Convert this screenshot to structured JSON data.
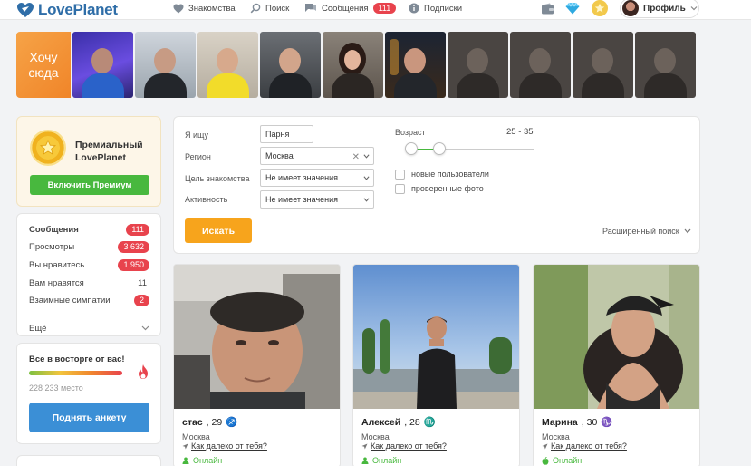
{
  "header": {
    "logo": "LovePlanet",
    "nav": [
      {
        "label": "Знакомства",
        "icon": "heart-icon"
      },
      {
        "label": "Поиск",
        "icon": "search-icon"
      },
      {
        "label": "Сообщения",
        "icon": "messages-icon",
        "badge": "111"
      },
      {
        "label": "Подписки",
        "icon": "info-icon"
      }
    ],
    "icons": [
      "wallet-icon",
      "diamond-icon",
      "star-icon"
    ],
    "profile_label": "Профиль"
  },
  "strip": {
    "want_here": "Хочу сюда",
    "photo_count": 10
  },
  "premium": {
    "title": "Премиальный LovePlanet",
    "button": "Включить Премиум"
  },
  "stats": {
    "items": [
      {
        "label": "Сообщения",
        "value": "111",
        "badge": true,
        "bold": true
      },
      {
        "label": "Просмотры",
        "value": "3 632",
        "badge": true
      },
      {
        "label": "Вы нравитесь",
        "value": "1 950",
        "badge": true
      },
      {
        "label": "Вам нравятся",
        "value": "11",
        "badge": false
      },
      {
        "label": "Взаимные симпатии",
        "value": "2",
        "badge": true
      }
    ],
    "more": "Ещё"
  },
  "delight": {
    "title": "Все в восторге от вас!",
    "place": "228 233 место",
    "button": "Поднять анкету"
  },
  "search": {
    "looking_for_label": "Я ищу",
    "looking_for_value": "Парня",
    "region_label": "Регион",
    "region_value": "Москва",
    "goal_label": "Цель знакомства",
    "goal_value": "Не имеет значения",
    "activity_label": "Активность",
    "activity_value": "Не имеет значения",
    "age_label": "Возраст",
    "age_range": "25 - 35",
    "checkbox_new": "новые пользователи",
    "checkbox_verified": "проверенные фото",
    "search_button": "Искать",
    "advanced": "Расширенный поиск"
  },
  "profiles": [
    {
      "name": "стас",
      "age": ", 29",
      "sign": "♐",
      "city": "Москва",
      "distance_link": "Как далеко от тебя?",
      "status": "Онлайн",
      "status_icon": "person-icon"
    },
    {
      "name": "Алексей",
      "age": ", 28",
      "sign": "♏",
      "city": "Москва",
      "distance_link": "Как далеко от тебя?",
      "status": "Онлайн",
      "status_icon": "person-icon"
    },
    {
      "name": "Марина",
      "age": ", 30",
      "sign": "♑",
      "city": "Москва",
      "distance_link": "Как далеко от тебя?",
      "status": "Онлайн",
      "status_icon": "apple-icon"
    }
  ],
  "colors": {
    "brand_blue": "#2f6ea8",
    "accent_orange": "#f7a41c",
    "badge_red": "#e8434d",
    "online_green": "#48b83e",
    "raise_blue": "#3b8fd6"
  }
}
